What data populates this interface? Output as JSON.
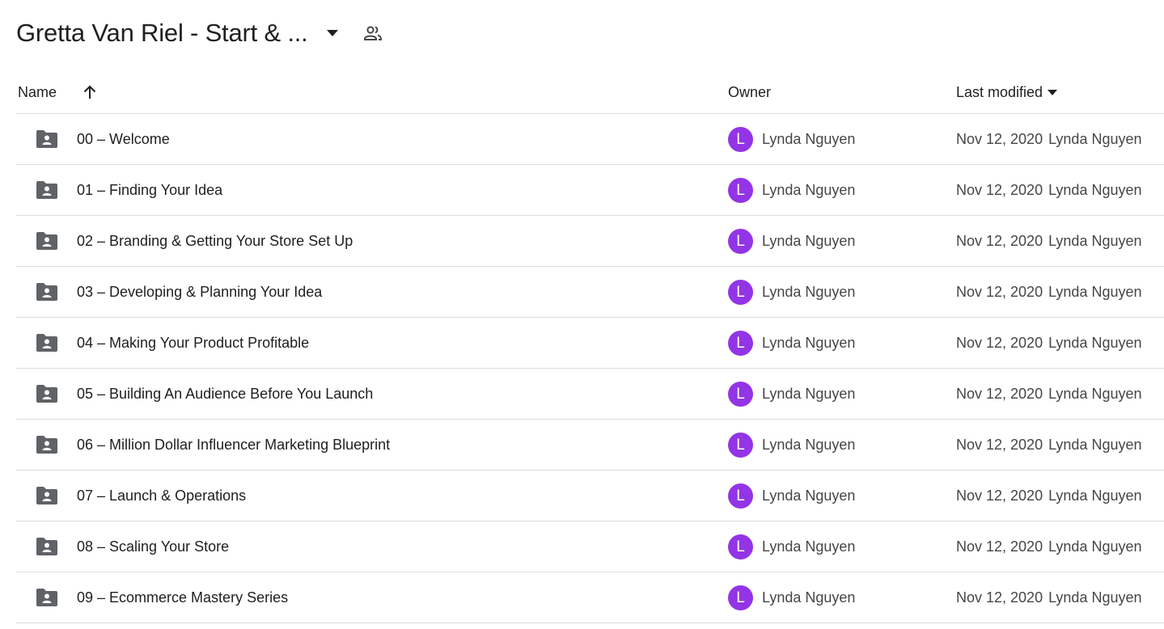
{
  "header": {
    "title": "Gretta Van Riel - Start & ...",
    "dropdown_icon": "arrow-drop-down-icon",
    "shared_icon": "people-icon"
  },
  "columns": {
    "name": "Name",
    "owner": "Owner",
    "last_modified": "Last modified"
  },
  "colors": {
    "avatar": "#9334e6",
    "folder": "#5f6368"
  },
  "rows": [
    {
      "name": "00 – Welcome",
      "avatar": "L",
      "owner": "Lynda Nguyen",
      "date": "Nov 12, 2020",
      "modified_by": "Lynda Nguyen"
    },
    {
      "name": "01 – Finding Your Idea",
      "avatar": "L",
      "owner": "Lynda Nguyen",
      "date": "Nov 12, 2020",
      "modified_by": "Lynda Nguyen"
    },
    {
      "name": "02 – Branding & Getting Your Store Set Up",
      "avatar": "L",
      "owner": "Lynda Nguyen",
      "date": "Nov 12, 2020",
      "modified_by": "Lynda Nguyen"
    },
    {
      "name": "03 – Developing & Planning Your Idea",
      "avatar": "L",
      "owner": "Lynda Nguyen",
      "date": "Nov 12, 2020",
      "modified_by": "Lynda Nguyen"
    },
    {
      "name": "04 – Making Your Product Profitable",
      "avatar": "L",
      "owner": "Lynda Nguyen",
      "date": "Nov 12, 2020",
      "modified_by": "Lynda Nguyen"
    },
    {
      "name": "05 – Building An Audience Before You Launch",
      "avatar": "L",
      "owner": "Lynda Nguyen",
      "date": "Nov 12, 2020",
      "modified_by": "Lynda Nguyen"
    },
    {
      "name": "06 – Million Dollar Influencer Marketing Blueprint",
      "avatar": "L",
      "owner": "Lynda Nguyen",
      "date": "Nov 12, 2020",
      "modified_by": "Lynda Nguyen"
    },
    {
      "name": "07 – Launch & Operations",
      "avatar": "L",
      "owner": "Lynda Nguyen",
      "date": "Nov 12, 2020",
      "modified_by": "Lynda Nguyen"
    },
    {
      "name": "08 – Scaling Your Store",
      "avatar": "L",
      "owner": "Lynda Nguyen",
      "date": "Nov 12, 2020",
      "modified_by": "Lynda Nguyen"
    },
    {
      "name": "09 – Ecommerce Mastery Series",
      "avatar": "L",
      "owner": "Lynda Nguyen",
      "date": "Nov 12, 2020",
      "modified_by": "Lynda Nguyen"
    }
  ]
}
